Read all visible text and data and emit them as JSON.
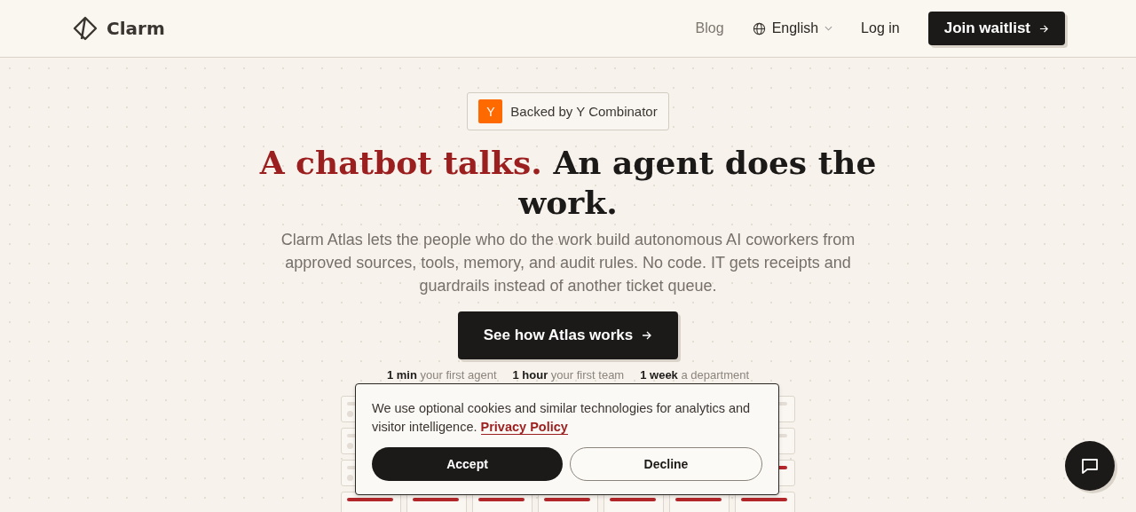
{
  "nav": {
    "brand": "Clarm",
    "links": [
      {
        "label": "Blog",
        "kind": "muted"
      },
      {
        "label": "English",
        "kind": "language"
      },
      {
        "label": "Log in",
        "kind": "plain"
      }
    ],
    "cta": "Join waitlist"
  },
  "badge": {
    "mark": "Y",
    "text": "Backed by Y Combinator"
  },
  "hero": {
    "title_accent": "A chatbot talks.",
    "title_rest": "An agent does the work.",
    "subtitle": "Clarm Atlas lets the people who do the work build autonomous AI coworkers from approved sources, tools, memory, and audit rules. No code. IT gets receipts and guardrails instead of another ticket queue.",
    "cta": "See how Atlas works"
  },
  "stats": [
    "**1 min** your first agent",
    "**1 hour** your first team",
    "**1 week** a department"
  ],
  "cookie_banner": {
    "text": "We use optional cookies and similar technologies for analytics and visitor intelligence.",
    "link": "Privacy Policy",
    "buttons": [
      {
        "label": "Accept",
        "kind": "primary"
      },
      {
        "label": "Decline",
        "kind": "secondary"
      }
    ]
  }
}
